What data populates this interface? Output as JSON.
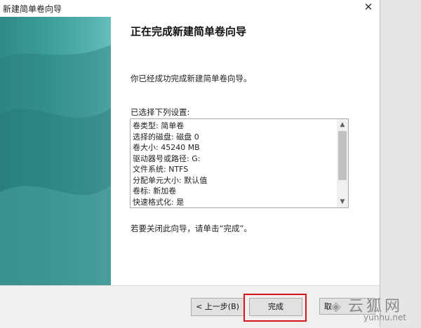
{
  "window": {
    "title": "新建简单卷向导",
    "close_glyph": "✕"
  },
  "main": {
    "heading": "正在完成新建简单卷向导",
    "success_text": "你已经成功完成新建简单卷向导。",
    "settings_label": "已选择下列设置:",
    "settings_lines": [
      "卷类型: 简单卷",
      "选择的磁盘: 磁盘 0",
      "卷大小: 45240 MB",
      "驱动器号或路径: G:",
      "文件系统: NTFS",
      "分配单元大小: 默认值",
      "卷标: 新加卷",
      "快速格式化: 是"
    ],
    "close_hint": "若要关闭此向导，请单击“完成”。"
  },
  "footer": {
    "back_label": "< 上一步(B)",
    "finish_label": "完成",
    "cancel_partial": "取"
  },
  "highlight": {
    "color": "#d0161b"
  },
  "watermark": {
    "logo_icon": "fox-icon",
    "text_cn": "云狐网",
    "text_en": "yunhu.net"
  }
}
